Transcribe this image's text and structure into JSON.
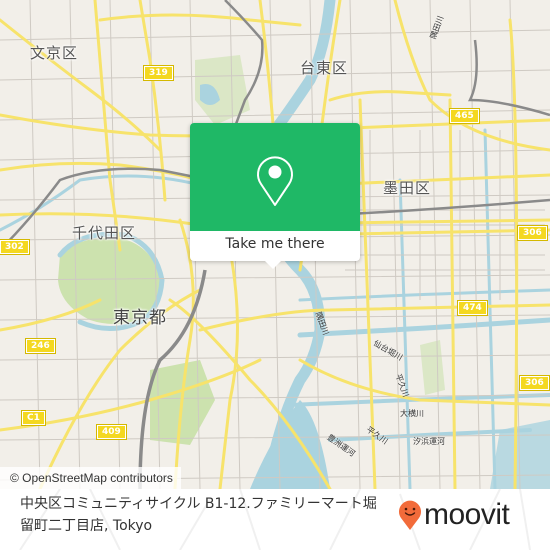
{
  "map": {
    "districts": [
      {
        "name": "文京区"
      },
      {
        "name": "台東区"
      },
      {
        "name": "墨田区"
      },
      {
        "name": "千代田区"
      },
      {
        "name": "東京都"
      }
    ],
    "route_shields": [
      "319",
      "465",
      "306",
      "302",
      "474",
      "246",
      "306",
      "C1",
      "409"
    ],
    "river_labels": [
      "隅田川",
      "隅田川",
      "仙台堀川",
      "平久川",
      "大横川",
      "平久川",
      "汐浜運河",
      "豊洲運河"
    ],
    "colors": {
      "land": "#f2efe9",
      "road_major": "#f7e36b",
      "road_minor": "#ffffff",
      "water": "#aad3df",
      "park": "#c8e0a8",
      "rail": "#888888"
    }
  },
  "popup": {
    "icon": "map-pin-icon",
    "button_label": "Take me there",
    "color": "#1fb866"
  },
  "attribution": "© OpenStreetMap contributors",
  "footer": {
    "place_name": "中央区コミュニティサイクル B1-12.ファミリーマート堀留町二丁目店, Tokyo",
    "logo_text": "moovit",
    "logo_color": "#f26b3a"
  }
}
